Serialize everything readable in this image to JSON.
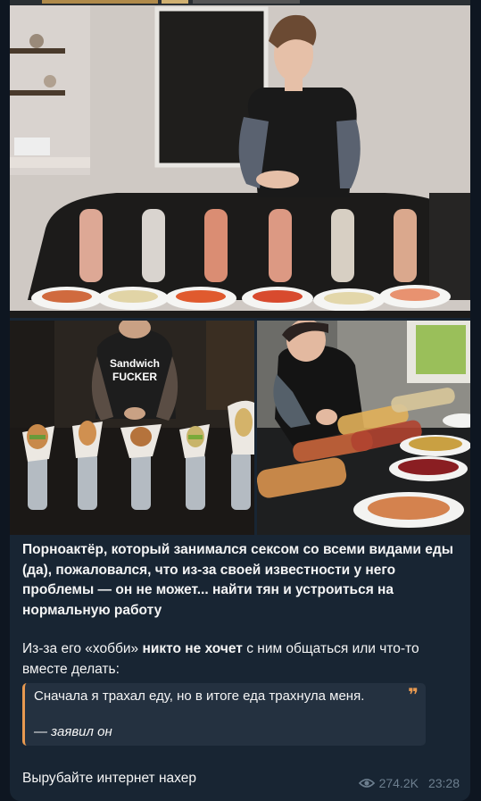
{
  "post": {
    "headline": "Порноактёр, который занимался сексом со всеми видами еды (да), пожаловался, что из-за своей известности у него проблемы — он не может... найти тян и устроиться на нормальную работу",
    "para_before": "Из-за его «хобби» ",
    "para_bold": "никто не хочет",
    "para_after": " с ним общаться или что-то вместе делать:",
    "quote_text": "Сначала я трахал еду, но в итоге еда трахнула меня.",
    "quote_author": "— заявил он",
    "quote_mark": "❞",
    "final_line": "Вырубайте интернет нахер",
    "views": "274.2K",
    "time": "23:28"
  },
  "photos": {
    "shirt_text_line1": "Sandwich",
    "shirt_text_line2": "FUCKER"
  },
  "colors": {
    "background": "#0e1621",
    "bubble": "#182533",
    "quote_bg": "#243140",
    "quote_accent": "#e79950",
    "meta": "#6d7f8f"
  },
  "icons": {
    "views": "eye-icon",
    "quote": "quote-mark-icon"
  }
}
